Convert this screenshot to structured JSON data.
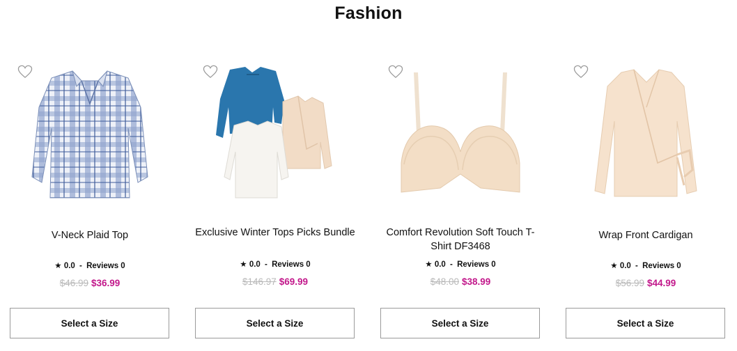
{
  "page": {
    "title": "Fashion"
  },
  "products": [
    {
      "name": "V-Neck Plaid Top",
      "rating_star": "★",
      "rating": "0.0",
      "rating_sep": "-",
      "reviews_label": "Reviews",
      "reviews_count": "0",
      "old_price": "$46.99",
      "new_price": "$36.99",
      "button": "Select a Size",
      "image_icon": "plaid-shirt-image"
    },
    {
      "name": "Exclusive Winter Tops Picks Bundle",
      "rating_star": "★",
      "rating": "0.0",
      "rating_sep": "-",
      "reviews_label": "Reviews",
      "reviews_count": "0",
      "old_price": "$146.97",
      "new_price": "$69.99",
      "button": "Select a Size",
      "image_icon": "tops-bundle-image"
    },
    {
      "name": "Comfort Revolution Soft Touch T-Shirt DF3468",
      "rating_star": "★",
      "rating": "0.0",
      "rating_sep": "-",
      "reviews_label": "Reviews",
      "reviews_count": "0",
      "old_price": "$48.00",
      "new_price": "$38.99",
      "button": "Select a Size",
      "image_icon": "bra-image"
    },
    {
      "name": "Wrap Front Cardigan",
      "rating_star": "★",
      "rating": "0.0",
      "rating_sep": "-",
      "reviews_label": "Reviews",
      "reviews_count": "0",
      "old_price": "$56.99",
      "new_price": "$44.99",
      "button": "Select a Size",
      "image_icon": "cardigan-image"
    }
  ],
  "colors": {
    "sale_price": "#c2188b",
    "old_price": "#b9b9b9",
    "button_border": "#9a9a9a"
  }
}
